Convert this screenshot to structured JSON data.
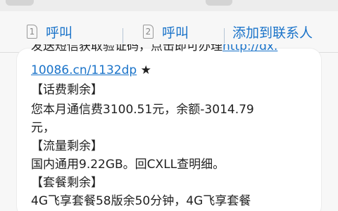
{
  "toolbar": {
    "call_sim1": {
      "sim": "1",
      "label": "呼叫"
    },
    "call_sim2": {
      "sim": "2",
      "label": "呼叫"
    },
    "add_contact": {
      "label": "添加到联系人"
    }
  },
  "message": {
    "partial_top_text": "发送短信获取验证码，点击即可办理",
    "partial_top_link": "http://dx.",
    "link_line": {
      "link": "10086.cn/1132dp",
      "suffix": " ★"
    },
    "section_fee_title": "【话费剩余】",
    "fee_line1": "您本月通信费3100.51元，余额-3014.79",
    "fee_line2": "元，",
    "section_data_title": "【流量剩余】",
    "data_line": "国内通用9.22GB。回CXLL查明细。",
    "section_package_title": "【套餐剩余】",
    "package_line": "4G飞享套餐58版余50分钟，4G飞享套餐"
  },
  "colors": {
    "accent": "#1a73c9",
    "text": "#1f1f1f",
    "bubble": "#ffffff",
    "background": "#f7f7f7"
  }
}
